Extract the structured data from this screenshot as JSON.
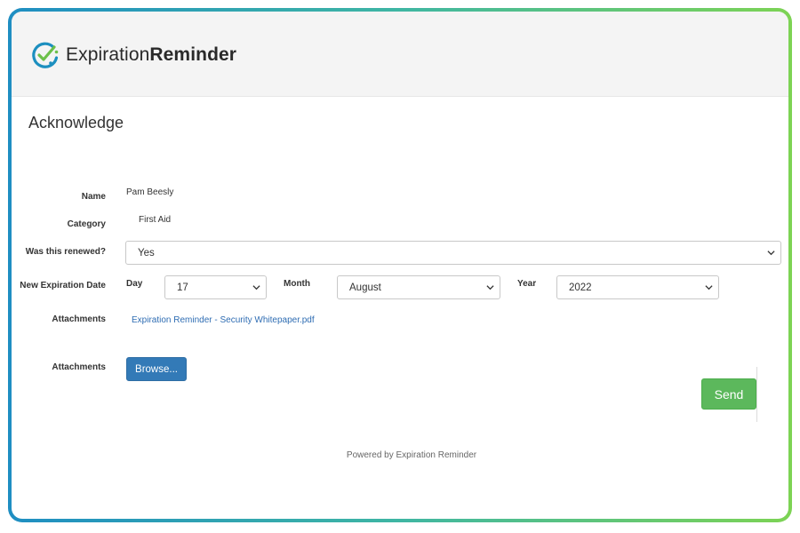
{
  "brand": {
    "name_light": "Expiration",
    "name_bold": "Reminder",
    "accent": "#3a9e52",
    "icon": "clock-check-icon"
  },
  "page": {
    "title": "Acknowledge"
  },
  "form": {
    "name": {
      "label": "Name",
      "value": "Pam Beesly"
    },
    "category": {
      "label": "Category",
      "value": "First Aid"
    },
    "renewed": {
      "label": "Was this renewed?",
      "value": "Yes"
    },
    "new_expiration": {
      "label": "New Expiration Date",
      "day_label": "Day",
      "day_value": "17",
      "month_label": "Month",
      "month_value": "August",
      "year_label": "Year",
      "year_value": "2022"
    },
    "attachments_existing": {
      "label": "Attachments",
      "file": "Expiration Reminder - Security Whitepaper.pdf"
    },
    "attachments_upload": {
      "label": "Attachments",
      "browse_label": "Browse..."
    }
  },
  "actions": {
    "send_label": "Send"
  },
  "footer": {
    "text": "Powered by Expiration Reminder"
  },
  "colors": {
    "send": "#5cb85c",
    "browse": "#337ab7",
    "link": "#2f6db3"
  }
}
